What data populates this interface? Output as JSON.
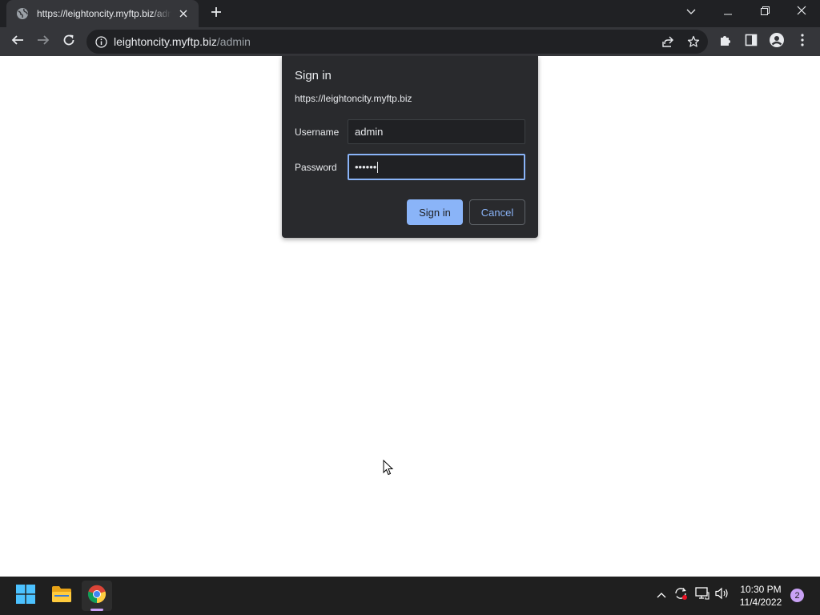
{
  "browser": {
    "tab": {
      "title": "https://leightoncity.myftp.biz/admin"
    },
    "address_bar": {
      "host": "leightoncity.myftp.biz",
      "path": "/admin"
    }
  },
  "dialog": {
    "title": "Sign in",
    "origin": "https://leightoncity.myftp.biz",
    "username_label": "Username",
    "username_value": "admin",
    "password_label": "Password",
    "password_value": "••••••",
    "sign_in_label": "Sign in",
    "cancel_label": "Cancel"
  },
  "taskbar": {
    "time": "10:30 PM",
    "date": "11/4/2022",
    "notification_count": "2"
  },
  "colors": {
    "accent": "#8ab4f8",
    "chrome_dark": "#202124",
    "chrome_toolbar": "#35363a",
    "taskbar": "#1f1f1f",
    "notification_badge": "#c9a2f5"
  },
  "icons": {
    "tab_favicon": "globe-icon",
    "tab_close": "close-icon",
    "new_tab": "plus-icon",
    "back": "back-arrow-icon",
    "forward": "forward-arrow-icon",
    "reload": "reload-icon",
    "site_info": "info-icon",
    "share": "share-icon",
    "bookmark": "star-icon",
    "extensions": "puzzle-icon",
    "side_panel": "side-panel-icon",
    "profile": "profile-icon",
    "menu": "kebab-menu-icon"
  }
}
